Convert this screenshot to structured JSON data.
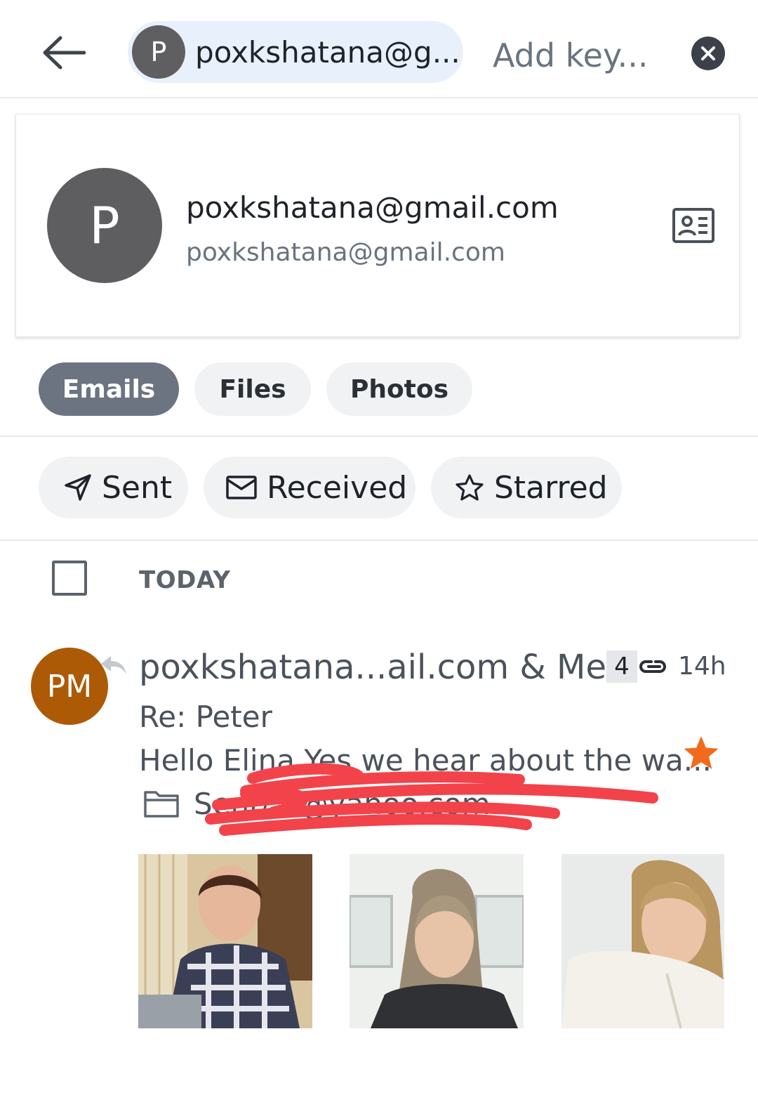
{
  "search": {
    "chip_initial": "P",
    "chip_label": "poxkshatana@g...",
    "placeholder": "Add key..."
  },
  "contact": {
    "initial": "P",
    "name": "poxkshatana@gmail.com",
    "email": "poxkshatana@gmail.com"
  },
  "tabs": [
    {
      "label": "Emails",
      "active": true
    },
    {
      "label": "Files",
      "active": false
    },
    {
      "label": "Photos",
      "active": false
    }
  ],
  "filters": [
    {
      "label": "Sent",
      "icon": "send-icon"
    },
    {
      "label": "Received",
      "icon": "envelope-icon"
    },
    {
      "label": "Starred",
      "icon": "star-outline-icon"
    }
  ],
  "list": {
    "section_label": "TODAY",
    "messages": [
      {
        "avatar_initials": "PM",
        "avatar_color": "#ad5a06",
        "sender": "poxkshatana...ail.com & Me",
        "count": "4",
        "time": "14h",
        "subject": "Re: Peter",
        "snippet": "Hello Elina Yes we hear about the wa...",
        "folder": "Sent/...@yahoo.com....",
        "starred": true,
        "star_color": "#f26a1b",
        "thumbnails": [
          "photo-thumbnail-1",
          "photo-thumbnail-2",
          "photo-thumbnail-3"
        ]
      }
    ]
  },
  "colors": {
    "accent_tab": "#6b7480",
    "chip_bg": "#e8f0fb",
    "redaction": "#f2434b"
  }
}
